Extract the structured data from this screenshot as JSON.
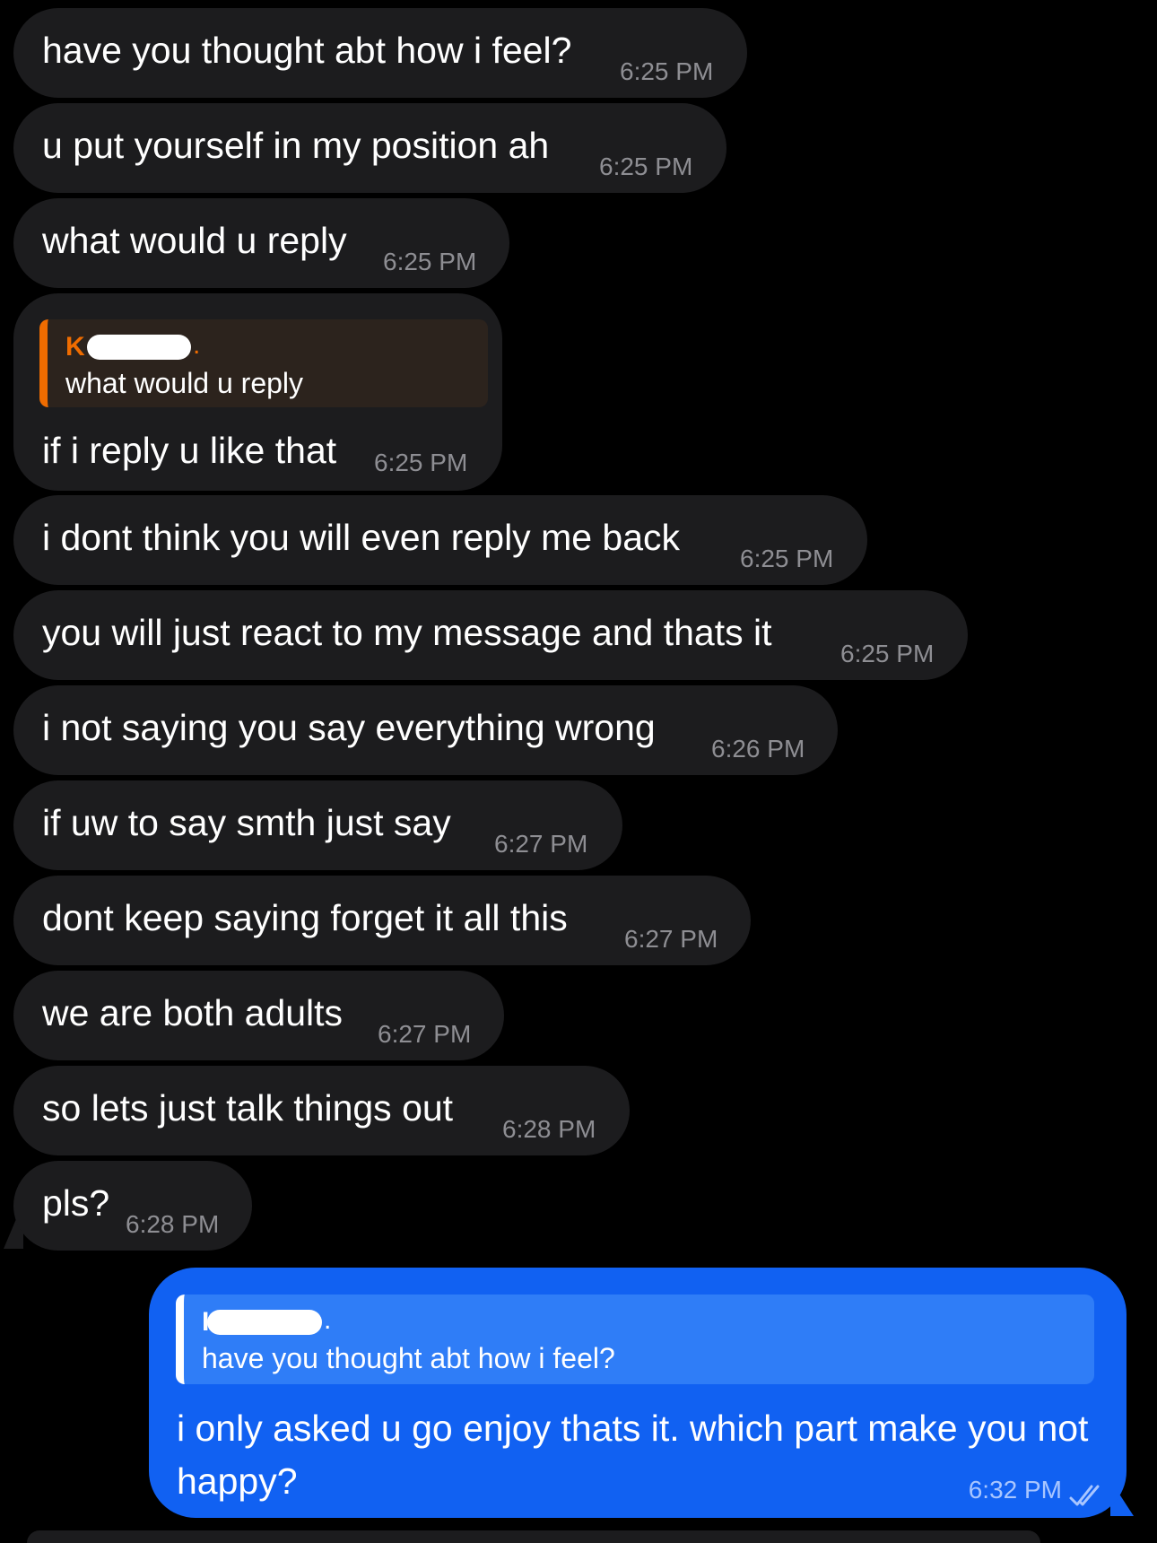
{
  "incoming_messages": [
    {
      "text": "have you thought abt how i feel?",
      "time": "6:25 PM"
    },
    {
      "text": "u put yourself in my position ah",
      "time": "6:25 PM"
    },
    {
      "text": "what would u reply",
      "time": "6:25 PM"
    },
    {
      "text": "if i reply u like that",
      "time": "6:25 PM",
      "quote": {
        "name": "K",
        "text": "what would u reply"
      }
    },
    {
      "text": "i dont think you will even reply me back",
      "time": "6:25 PM"
    },
    {
      "text": "you will just react to my message and thats it",
      "time": "6:25 PM"
    },
    {
      "text": "i not saying you say everything wrong",
      "time": "6:26 PM"
    },
    {
      "text": "if uw to say smth just say",
      "time": "6:27 PM"
    },
    {
      "text": "dont keep saying forget it all this",
      "time": "6:27 PM"
    },
    {
      "text": "we are both adults",
      "time": "6:27 PM"
    },
    {
      "text": "so lets just talk things out",
      "time": "6:28 PM"
    },
    {
      "text": "pls?",
      "time": "6:28 PM"
    }
  ],
  "outgoing_message": {
    "quote": {
      "name": "I",
      "text": "have you thought abt how i feel?"
    },
    "text": "i only asked u go enjoy thats it. which part make you not happy?",
    "time": "6:32 PM",
    "status_icon": "double-check-icon"
  },
  "colors": {
    "background": "#000000",
    "incoming_bubble": "#1c1c1e",
    "outgoing_bubble": "#1161f2",
    "reply_accent_incoming": "#ef6c00",
    "timestamp_incoming": "#8e8e93"
  }
}
